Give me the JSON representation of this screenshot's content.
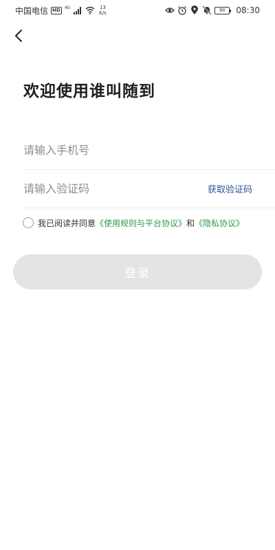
{
  "status_bar": {
    "carrier": "中国电信",
    "hd": "HD",
    "net": "4G",
    "speed_value": "13",
    "speed_unit": "K/s",
    "battery": "90",
    "time": "08:30"
  },
  "title": "欢迎使用谁叫随到",
  "phone_field": {
    "placeholder": "请输入手机号"
  },
  "code_field": {
    "placeholder": "请输入验证码",
    "get_code_label": "获取验证码"
  },
  "agreement": {
    "prefix": "我已阅读并同意",
    "terms_link": "《使用规则与平台协议》",
    "conjunction": "和",
    "privacy_link": "《隐私协议》"
  },
  "login_button": {
    "label": "登录"
  },
  "colors": {
    "link_green": "#2a9a4a",
    "link_blue": "#2a5599",
    "button_disabled": "#e4e4e4"
  }
}
